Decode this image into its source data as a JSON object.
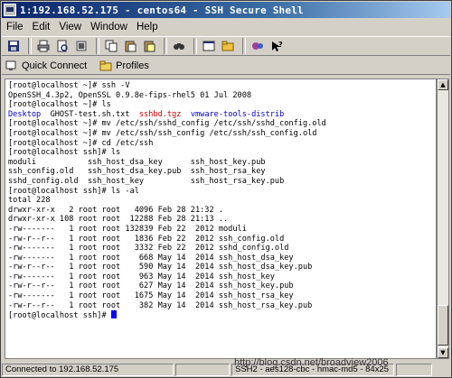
{
  "window": {
    "title": "1:192.168.52.175 - centos64 - SSH Secure Shell"
  },
  "menu": {
    "items": [
      "File",
      "Edit",
      "View",
      "Window",
      "Help"
    ]
  },
  "toolbar": {
    "icons": [
      "save-icon",
      "print-icon",
      "print-preview-icon",
      "connect-icon",
      "copy-icon",
      "paste-icon",
      "paste-selected-icon",
      "find-icon",
      "new-terminal-icon",
      "file-transfer-icon",
      "settings-icon",
      "help-icon"
    ]
  },
  "quickbar": {
    "quick_connect": "Quick Connect",
    "profiles": "Profiles"
  },
  "terminal": {
    "lines": [
      {
        "text": "[root@localhost ~]# ssh -V"
      },
      {
        "text": "OpenSSH_4.3p2, OpenSSL 0.9.8e-fips-rhel5 01 Jul 2008"
      },
      {
        "text": "[root@localhost ~]# ls"
      },
      {
        "segments": [
          {
            "text": "Desktop",
            "color": "blue"
          },
          {
            "text": "  GHOST-test.sh.txt  ",
            "color": "default"
          },
          {
            "text": "sshbd.tgz",
            "color": "red"
          },
          {
            "text": "  ",
            "color": "default"
          },
          {
            "text": "vmware-tools-distrib",
            "color": "blue"
          }
        ]
      },
      {
        "text": "[root@localhost ~]# mv /etc/ssh/sshd_config /etc/ssh/sshd_config.old"
      },
      {
        "text": "[root@localhost ~]# mv /etc/ssh/ssh_config /etc/ssh/ssh_config.old"
      },
      {
        "text": "[root@localhost ~]# cd /etc/ssh"
      },
      {
        "text": "[root@localhost ssh]# ls"
      },
      {
        "text": "moduli           ssh_host_dsa_key      ssh_host_key.pub"
      },
      {
        "text": "ssh_config.old   ssh_host_dsa_key.pub  ssh_host_rsa_key"
      },
      {
        "text": "sshd_config.old  ssh_host_key          ssh_host_rsa_key.pub"
      },
      {
        "text": "[root@localhost ssh]# ls -al"
      },
      {
        "text": "total 228"
      },
      {
        "text": "drwxr-xr-x   2 root root   4096 Feb 28 21:32 ."
      },
      {
        "text": "drwxr-xr-x 108 root root  12288 Feb 28 21:13 .."
      },
      {
        "text": "-rw-------   1 root root 132839 Feb 22  2012 moduli"
      },
      {
        "text": "-rw-r--r--   1 root root   1836 Feb 22  2012 ssh_config.old"
      },
      {
        "text": "-rw-------   1 root root   3332 Feb 22  2012 sshd_config.old"
      },
      {
        "text": "-rw-------   1 root root    668 May 14  2014 ssh_host_dsa_key"
      },
      {
        "text": "-rw-r--r--   1 root root    590 May 14  2014 ssh_host_dsa_key.pub"
      },
      {
        "text": "-rw-------   1 root root    963 May 14  2014 ssh_host_key"
      },
      {
        "text": "-rw-r--r--   1 root root    627 May 14  2014 ssh_host_key.pub"
      },
      {
        "text": "-rw-------   1 root root   1675 May 14  2014 ssh_host_rsa_key"
      },
      {
        "text": "-rw-r--r--   1 root root    382 May 14  2014 ssh_host_rsa_key.pub"
      },
      {
        "text": "[root@localhost ssh]# ",
        "cursor": true
      }
    ]
  },
  "status": {
    "connection": "Connected to 192.168.52.175",
    "cipher": "SSH2 - aes128-cbc - hmac-md5 - 84x25"
  },
  "watermark": "http://blog.csdn.net/broadview2006"
}
